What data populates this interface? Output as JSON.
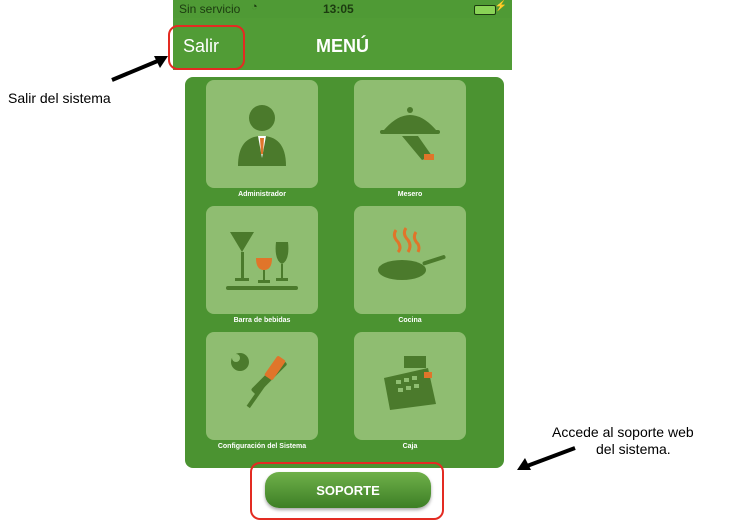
{
  "status_bar": {
    "carrier": "Sin servicio",
    "time": "13:05"
  },
  "nav": {
    "back_label": "Salir",
    "title": "MENÚ"
  },
  "tiles": [
    {
      "label": "Administrador",
      "icon": "waiter-icon"
    },
    {
      "label": "Mesero",
      "icon": "serving-tray-icon"
    },
    {
      "label": "Barra de bebidas",
      "icon": "drinks-icon"
    },
    {
      "label": "Cocina",
      "icon": "frying-pan-icon"
    },
    {
      "label": "Configuración del Sistema",
      "icon": "tools-icon"
    },
    {
      "label": "Caja",
      "icon": "cash-register-icon"
    }
  ],
  "support_button": {
    "label": "SOPORTE"
  },
  "annotations": {
    "salir": "Salir del sistema",
    "soporte_line1": "Accede al soporte web",
    "soporte_line2": "del sistema."
  },
  "colors": {
    "green": "#4b9331",
    "tile": "#8fbd71",
    "highlight": "#e32b22"
  }
}
